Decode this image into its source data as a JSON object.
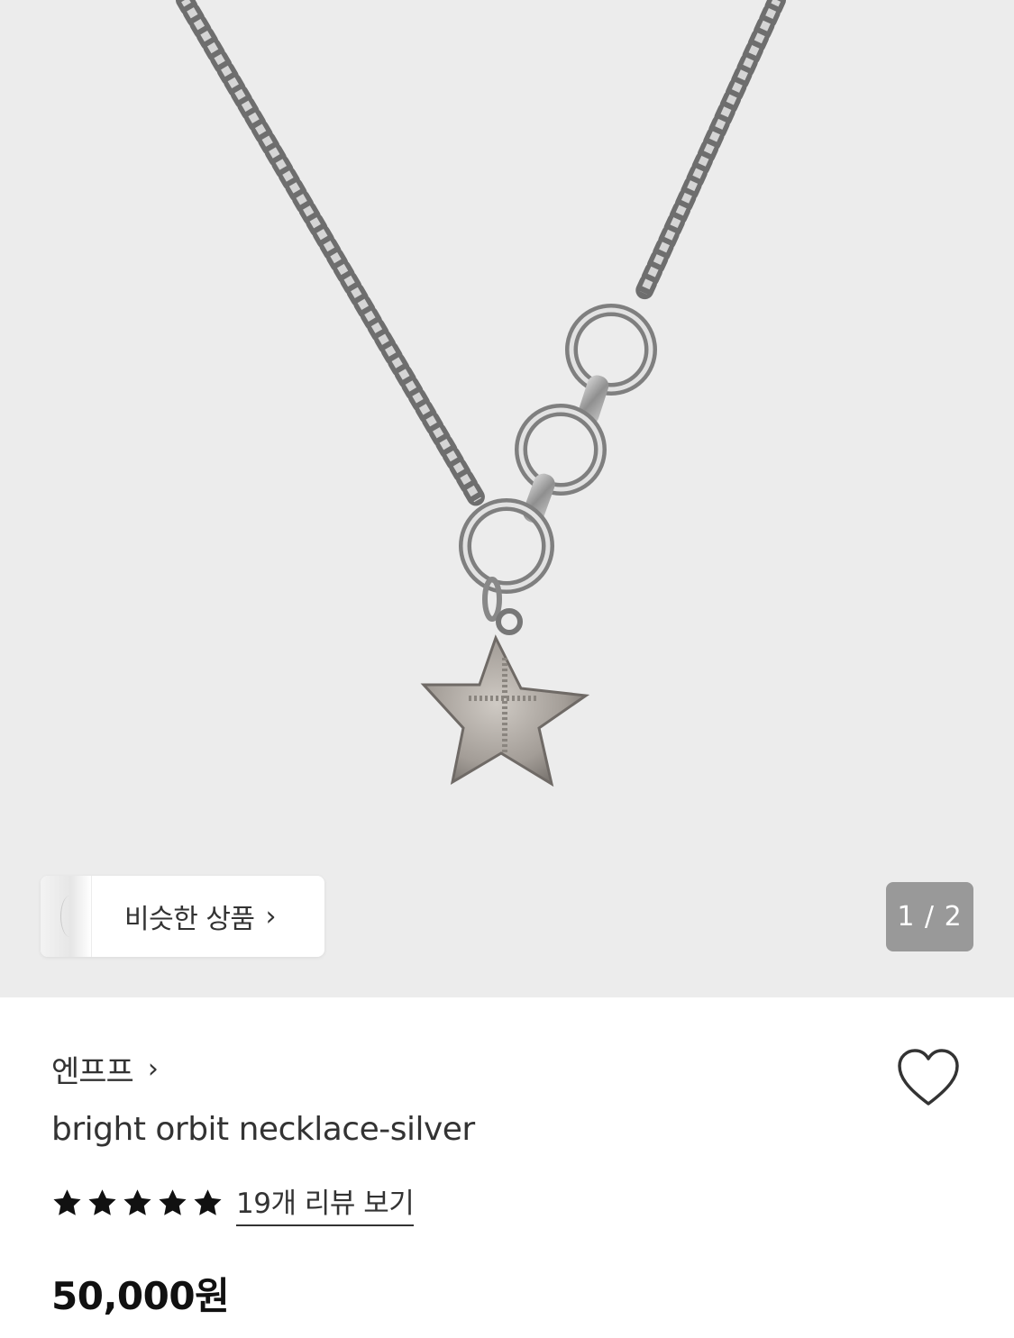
{
  "hero": {
    "similar_button": {
      "label": "비슷한 상품",
      "chevron": "›",
      "icon": "chevron-right-icon"
    },
    "page_indicator": {
      "text": "1 / 2"
    }
  },
  "product": {
    "brand": "엔프프",
    "brand_chevron": "›",
    "title": "bright orbit necklace-silver",
    "rating": 5,
    "rating_max": 5,
    "review_link": "19개 리뷰 보기",
    "price": "50,000원",
    "wishlist_icon": "heart-outline-icon"
  },
  "colors": {
    "hero_background": "#ececec",
    "text_primary": "#333333",
    "indicator_bg": "#7a7a7a"
  }
}
